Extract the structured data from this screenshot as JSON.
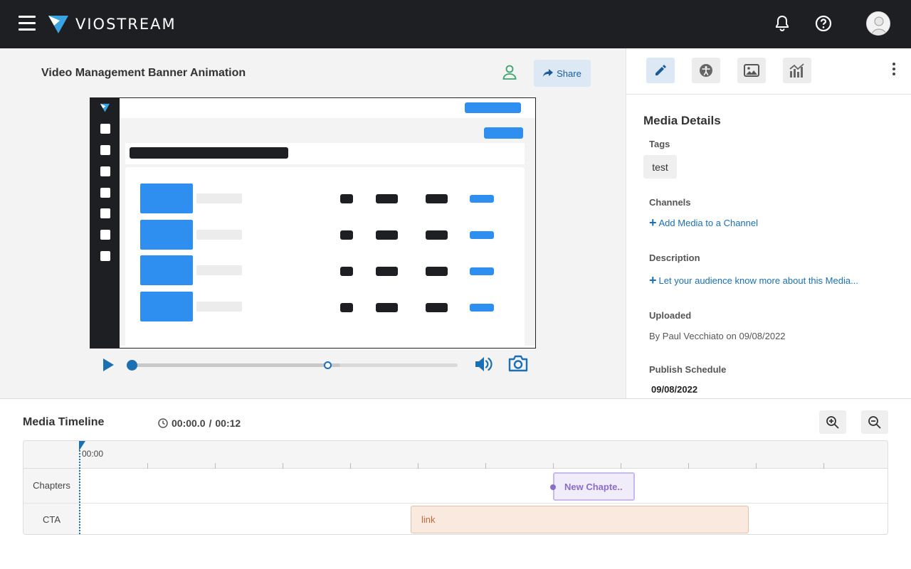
{
  "app": {
    "brand": "VIOSTREAM"
  },
  "colors": {
    "topbar": "#1e1f22",
    "accent": "#1b6fb3",
    "chapter": "#8a6cc9",
    "cta": "#b86a3e"
  },
  "header": {
    "icons": [
      "menu-icon",
      "bell-icon",
      "help-icon",
      "avatar"
    ]
  },
  "media": {
    "title": "Video Management Banner Animation",
    "share_label": "Share"
  },
  "player": {
    "progress_fraction": 0.0,
    "buffered_fraction": 0.64
  },
  "details": {
    "heading": "Media Details",
    "tags_label": "Tags",
    "tags": [
      "test"
    ],
    "channels_label": "Channels",
    "add_channel_link": "Add Media to a Channel",
    "description_label": "Description",
    "description_link": "Let your audience know more about this Media...",
    "uploaded_label": "Uploaded",
    "uploaded_text": "By Paul Vecchiato on 09/08/2022",
    "publish_label": "Publish Schedule",
    "publish_date": "09/08/2022"
  },
  "tabs": [
    "edit-tab",
    "accessibility-tab",
    "thumbnail-tab",
    "analytics-tab"
  ],
  "timeline": {
    "title": "Media Timeline",
    "current_time": "00:00.0",
    "separator": "/",
    "duration": "00:12",
    "zero_label": "00:00",
    "rows": [
      "Chapters",
      "CTA"
    ],
    "chapter_label": "New Chapte..",
    "cta_label": "link"
  }
}
